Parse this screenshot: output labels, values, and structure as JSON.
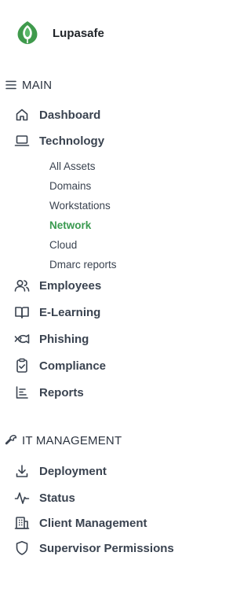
{
  "brand": {
    "name": "Lupasafe",
    "logo_icon": "lupasafe-leaf-logo",
    "logo_color": "#3f9a4c"
  },
  "sections": {
    "main": {
      "label": "MAIN",
      "icon": "menu-icon"
    },
    "it_management": {
      "label": "IT MANAGEMENT",
      "icon": "wrench-icon"
    }
  },
  "nav": {
    "dashboard": {
      "label": "Dashboard",
      "icon": "home-icon"
    },
    "technology": {
      "label": "Technology",
      "icon": "laptop-icon",
      "children": [
        {
          "label": "All Assets",
          "active": false
        },
        {
          "label": "Domains",
          "active": false
        },
        {
          "label": "Workstations",
          "active": false
        },
        {
          "label": "Network",
          "active": true
        },
        {
          "label": "Cloud",
          "active": false
        },
        {
          "label": "Dmarc reports",
          "active": false
        }
      ]
    },
    "employees": {
      "label": "Employees",
      "icon": "users-icon"
    },
    "elearning": {
      "label": "E-Learning",
      "icon": "book-open-icon"
    },
    "phishing": {
      "label": "Phishing",
      "icon": "fish-icon"
    },
    "compliance": {
      "label": "Compliance",
      "icon": "clipboard-check-icon"
    },
    "reports": {
      "label": "Reports",
      "icon": "report-lines-icon"
    },
    "deployment": {
      "label": "Deployment",
      "icon": "download-icon"
    },
    "status": {
      "label": "Status",
      "icon": "activity-icon"
    },
    "client_management": {
      "label": "Client Management",
      "icon": "building-icon"
    },
    "supervisor_permissions": {
      "label": "Supervisor Permissions",
      "icon": "shield-icon"
    }
  },
  "colors": {
    "active": "#3a9a50",
    "text": "#3a4350",
    "icon": "#3a4350"
  }
}
